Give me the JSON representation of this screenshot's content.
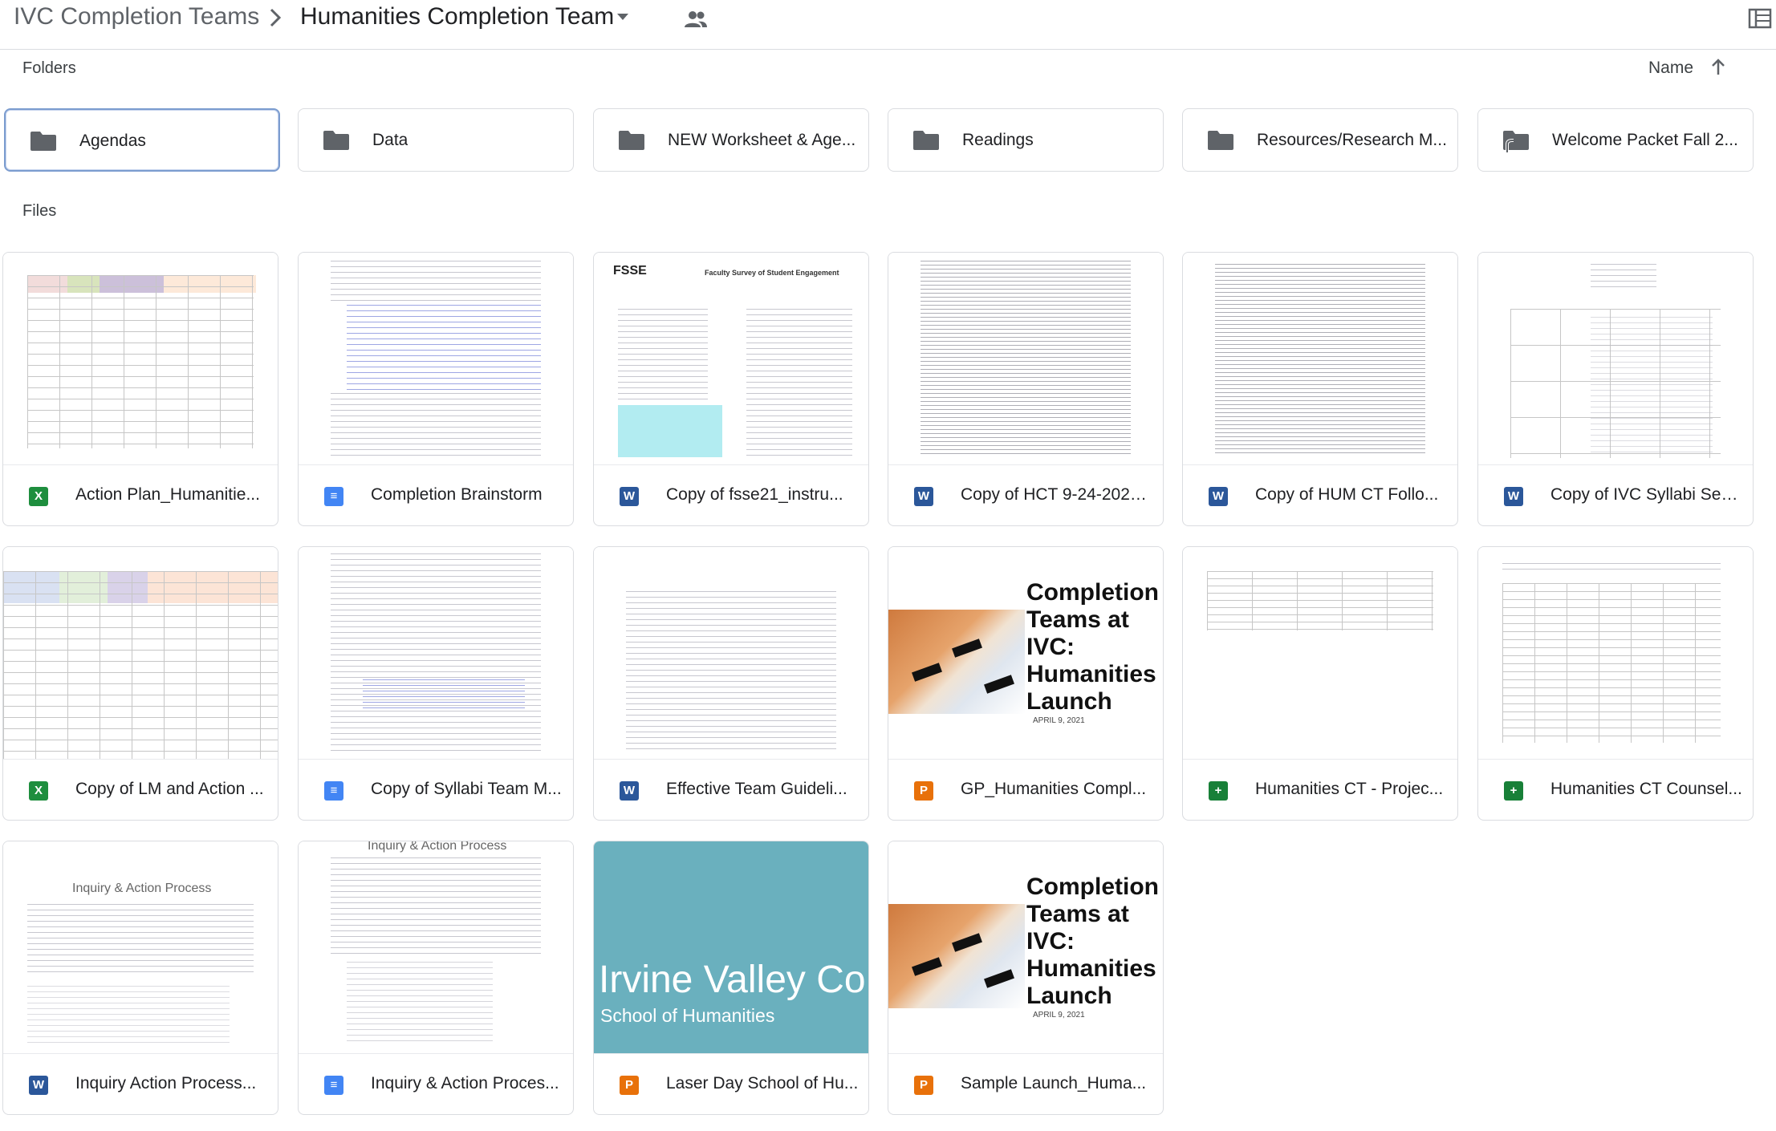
{
  "breadcrumb": {
    "root": "IVC Completion Teams",
    "separator": ">",
    "current": "Humanities Completion Team"
  },
  "icons": {
    "shared": "people-icon",
    "details": "details-list-icon",
    "folder": "folder-icon",
    "shortcut_folder": "folder-shortcut-icon"
  },
  "sections": {
    "folders": "Folders",
    "files": "Files"
  },
  "sort": {
    "label": "Name",
    "direction": "ascending"
  },
  "folders": [
    {
      "name": "Agendas",
      "selected": true,
      "shortcut": false
    },
    {
      "name": "Data",
      "selected": false,
      "shortcut": false
    },
    {
      "name": "NEW Worksheet & Age...",
      "selected": false,
      "shortcut": false
    },
    {
      "name": "Readings",
      "selected": false,
      "shortcut": false
    },
    {
      "name": "Resources/Research M...",
      "selected": false,
      "shortcut": false
    },
    {
      "name": "Welcome Packet Fall 2...",
      "selected": false,
      "shortcut": true
    }
  ],
  "files": [
    {
      "name": "Action Plan_Humanitie...",
      "type": "sheet",
      "type_glyph": "X"
    },
    {
      "name": "Completion Brainstorm",
      "type": "doc",
      "type_glyph": "≡"
    },
    {
      "name": "Copy of fsse21_instru...",
      "type": "word",
      "type_glyph": "W"
    },
    {
      "name": "Copy of HCT 9-24-2021...",
      "type": "word",
      "type_glyph": "W"
    },
    {
      "name": "Copy of HUM CT Follo...",
      "type": "word",
      "type_glyph": "W"
    },
    {
      "name": "Copy of IVC Syllabi Ses...",
      "type": "word",
      "type_glyph": "W"
    },
    {
      "name": "Copy of LM and Action ...",
      "type": "sheet",
      "type_glyph": "X"
    },
    {
      "name": "Copy of Syllabi Team M...",
      "type": "doc",
      "type_glyph": "≡"
    },
    {
      "name": "Effective Team Guideli...",
      "type": "word",
      "type_glyph": "W"
    },
    {
      "name": "GP_Humanities Compl...",
      "type": "ppt",
      "type_glyph": "P"
    },
    {
      "name": "Humanities CT - Projec...",
      "type": "gsheet",
      "type_glyph": "+"
    },
    {
      "name": "Humanities CT Counsel...",
      "type": "gsheet",
      "type_glyph": "+"
    },
    {
      "name": "Inquiry Action Process...",
      "type": "word",
      "type_glyph": "W"
    },
    {
      "name": "Inquiry & Action Proces...",
      "type": "doc",
      "type_glyph": "≡"
    },
    {
      "name": "Laser Day School of Hu...",
      "type": "ppt",
      "type_glyph": "P"
    },
    {
      "name": "Sample Launch_Huma...",
      "type": "ppt",
      "type_glyph": "P"
    }
  ],
  "thumbnails": {
    "fsse_logo": "FSSE",
    "fsse_title": "Faculty Survey of Student Engagement",
    "slide_title": "Completion Teams at IVC: Humanities Launch",
    "slide_date": "APRIL 9, 2021",
    "inquiry_heading": "Inquiry & Action Process",
    "laser_big": "Irvine Valley Co",
    "laser_small": "School of Humanities"
  },
  "colors": {
    "accent_selected": "#7b9ccf",
    "sheet": "#1e8e3e",
    "gsheet": "#188038",
    "doc": "#4285f4",
    "word": "#2b579a",
    "ppt": "#e8710a",
    "laser_teal": "#6ab0be"
  }
}
